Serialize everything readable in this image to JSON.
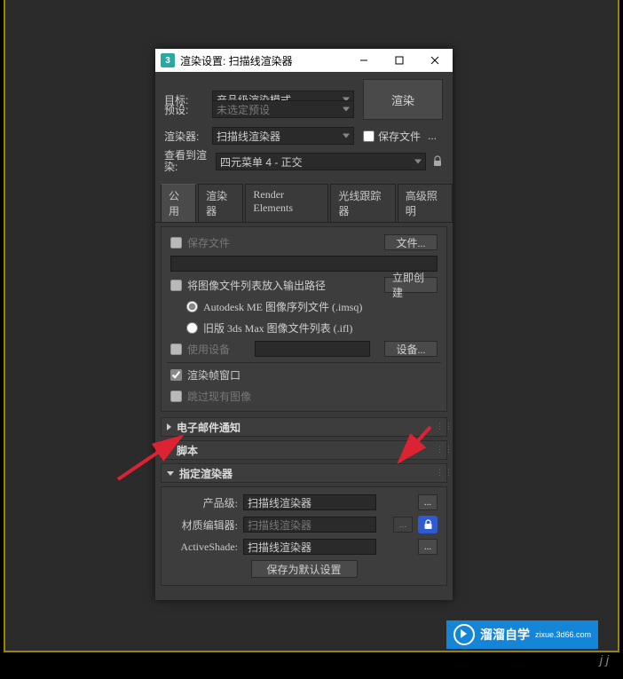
{
  "titlebar": {
    "title": "渲染设置: 扫描线渲染器"
  },
  "top": {
    "target_label": "目标:",
    "target_value": "产品级渲染模式",
    "preset_label": "预设:",
    "preset_value": "未选定预设",
    "renderer_label": "渲染器:",
    "renderer_value": "扫描线渲染器",
    "save_file_label": "保存文件",
    "view_label": "查看到渲染:",
    "view_value": "四元菜单 4 - 正交",
    "render_button": "渲染"
  },
  "tabs": [
    "公用",
    "渲染器",
    "Render Elements",
    "光线跟踪器",
    "高级照明"
  ],
  "output": {
    "save_file_label": "保存文件",
    "file_btn": "文件...",
    "put_imgseq_label": "将图像文件列表放入输出路径",
    "create_now_btn": "立即创建",
    "opt_autodesk": "Autodesk ME 图像序列文件 (.imsq)",
    "opt_legacy": "旧版 3ds Max 图像文件列表 (.ifl)",
    "use_device_label": "使用设备",
    "device_btn": "设备...",
    "render_frame_window": "渲染帧窗口",
    "skip_existing": "跳过现有图像"
  },
  "rollouts": {
    "email": "电子邮件通知",
    "scripts": "脚本",
    "assign_renderer": "指定渲染器"
  },
  "assign": {
    "production_label": "产品级:",
    "production_value": "扫描线渲染器",
    "mat_editor_label": "材质编辑器:",
    "mat_editor_value": "扫描线渲染器",
    "activeshade_label": "ActiveShade:",
    "activeshade_value": "扫描线渲染器",
    "save_defaults": "保存为默认设置"
  },
  "badge": {
    "text": "溜溜自学",
    "sub": "zixue.3d66.com"
  },
  "watermark": "j   j"
}
